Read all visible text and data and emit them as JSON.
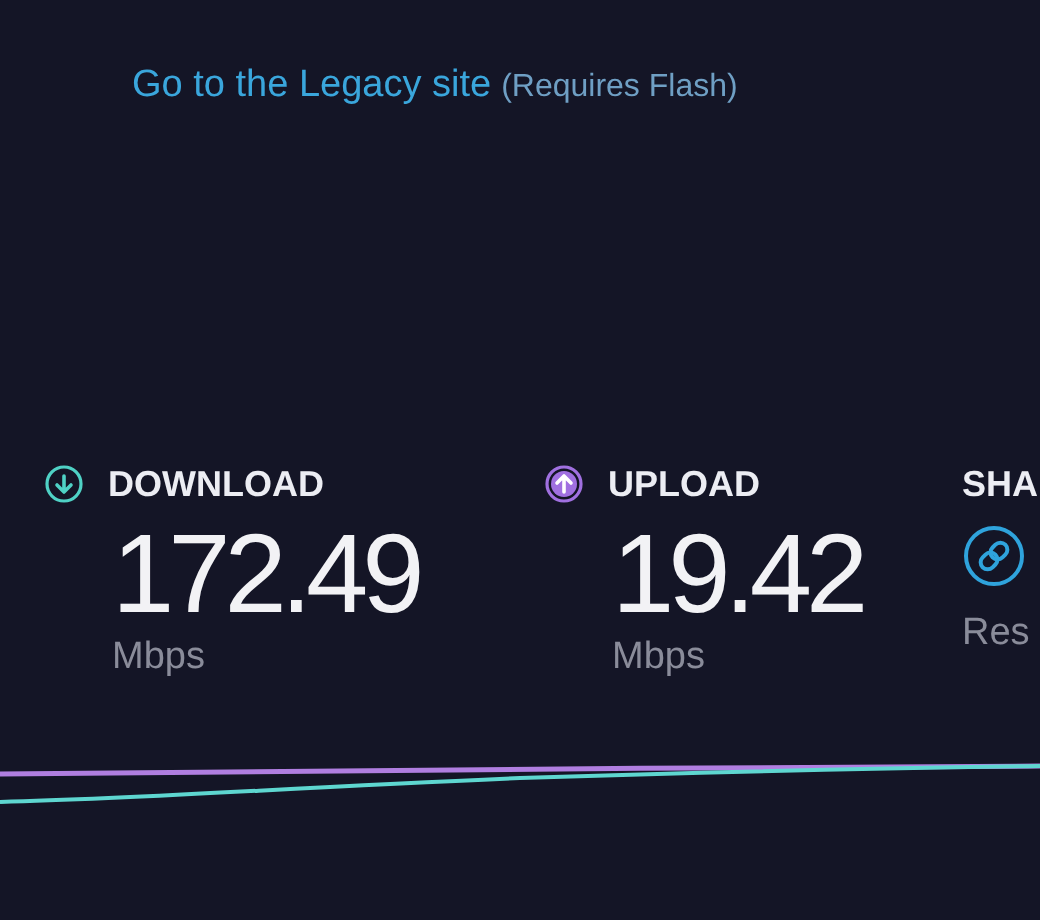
{
  "legacy_link": {
    "text": "Go to the Legacy site",
    "note": "(Requires Flash)"
  },
  "results": [
    {
      "kind": "download",
      "label": "DOWNLOAD",
      "value": "172.49",
      "unit": "Mbps"
    },
    {
      "kind": "upload",
      "label": "UPLOAD",
      "value": "19.42",
      "unit": "Mbps"
    },
    {
      "kind": "share",
      "label": "SHA",
      "caption": "Res"
    }
  ]
}
